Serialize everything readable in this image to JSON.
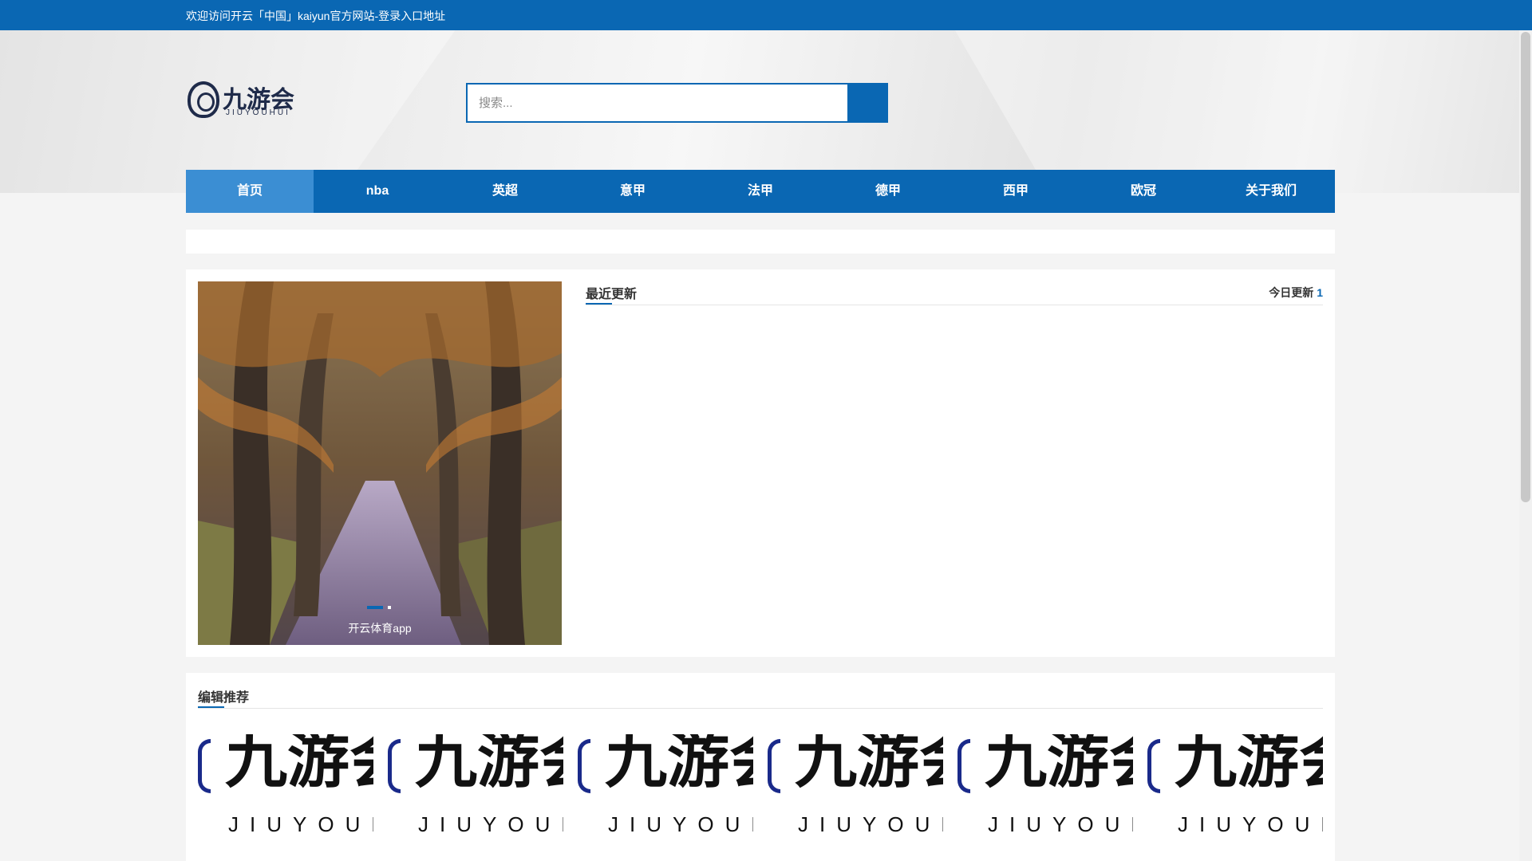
{
  "topbar": {
    "welcome": "欢迎访问开云「中国」kaiyun官方网站-登录入口地址"
  },
  "logo": {
    "cn": "九游会",
    "en": "JIUYOUHUI"
  },
  "search": {
    "placeholder": "搜索..."
  },
  "nav": {
    "items": [
      "首页",
      "nba",
      "英超",
      "意甲",
      "法甲",
      "德甲",
      "西甲",
      "欧冠",
      "关于我们"
    ],
    "active": "首页"
  },
  "slider": {
    "caption": "开云体育app",
    "slides": 2,
    "current": 1
  },
  "recent": {
    "title": "最近更新",
    "today_label": "今日更新",
    "today_count": "1"
  },
  "editor": {
    "title": "编辑推荐",
    "items": [
      {
        "cn": "九游会",
        "en": "JIUYOUHUI"
      },
      {
        "cn": "九游会",
        "en": "JIUYOUHUI"
      },
      {
        "cn": "九游会",
        "en": "JIUYOUHUI"
      },
      {
        "cn": "九游会",
        "en": "JIUYOUHUI"
      },
      {
        "cn": "九游会",
        "en": "JIUYOUHUI"
      },
      {
        "cn": "九游会",
        "en": "JIUYOUHUI"
      }
    ]
  },
  "colors": {
    "brand": "#0a67b3",
    "nav_active": "#3b8ed3"
  },
  "icons": {
    "search_button": "search-icon"
  }
}
